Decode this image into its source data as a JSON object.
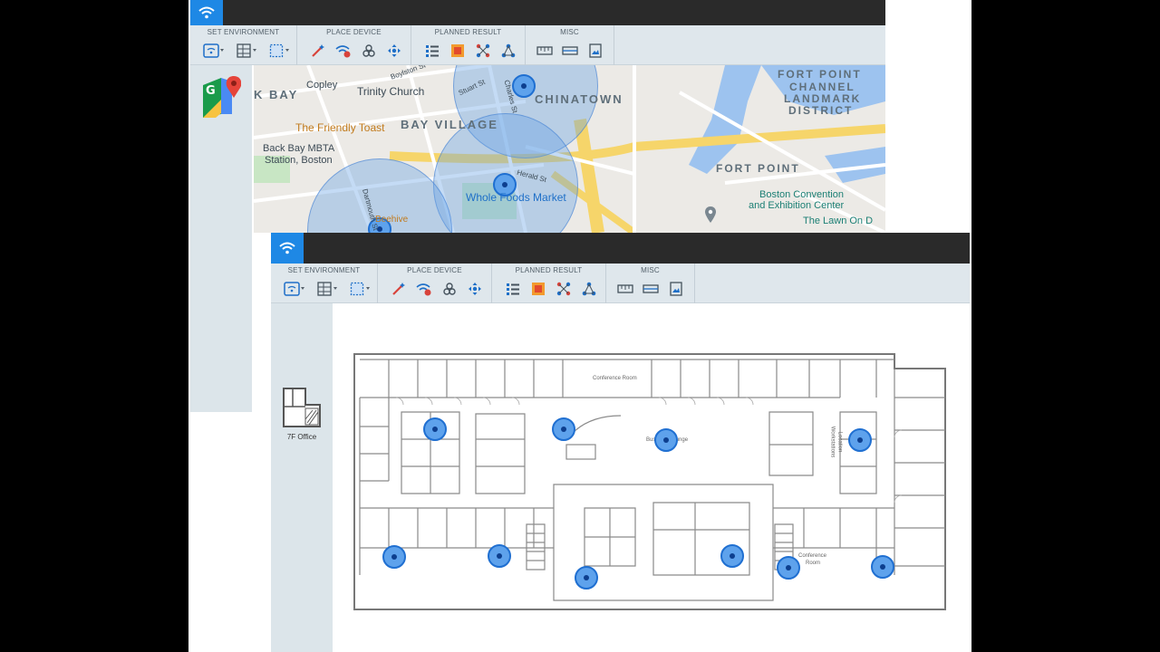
{
  "toolbar": {
    "groups": [
      {
        "label": "SET ENVIRONMENT"
      },
      {
        "label": "PLACE DEVICE"
      },
      {
        "label": "PLANNED RESULT"
      },
      {
        "label": "MISC"
      }
    ]
  },
  "map": {
    "district_labels": [
      "K BAY",
      "CHINATOWN",
      "BAY VILLAGE",
      "FORT POINT CHANNEL LANDMARK DISTRICT",
      "FORT POINT"
    ],
    "district_lines": {
      "fort_point_1": "FORT POINT",
      "fort_point_2": "CHANNEL",
      "fort_point_3": "LANDMARK",
      "fort_point_4": "DISTRICT"
    },
    "places": {
      "copley": "Copley",
      "trinity": "Trinity Church",
      "friendly_toast": "The Friendly Toast",
      "back_bay_1": "Back Bay MBTA",
      "back_bay_2": "Station, Boston",
      "whole_foods": "Whole Foods Market",
      "bcec_1": "Boston Convention",
      "bcec_2": "and Exhibition Center",
      "lawn": "The Lawn On D",
      "beehive": "Beehive",
      "boylston": "Boylston St",
      "stuart": "Stuart St",
      "charles": "Charles St",
      "herald": "Herald St",
      "dartmouth": "Dartmouth St"
    }
  },
  "floor": {
    "floor_name": "7F Office",
    "rooms": {
      "conference_top": "Conference Room",
      "lounge": "Business Lounge",
      "workstations_1": "Workstations",
      "workstations_2": "Location",
      "conference_bottom_1": "Conference",
      "conference_bottom_2": "Room"
    }
  },
  "colors": {
    "accent": "#1e88e5",
    "titlebar": "#2a2a2a",
    "toolbar_bg": "#dfe7ec",
    "coverage": "#64a0e6",
    "ap_core": "#0d3f8f"
  }
}
